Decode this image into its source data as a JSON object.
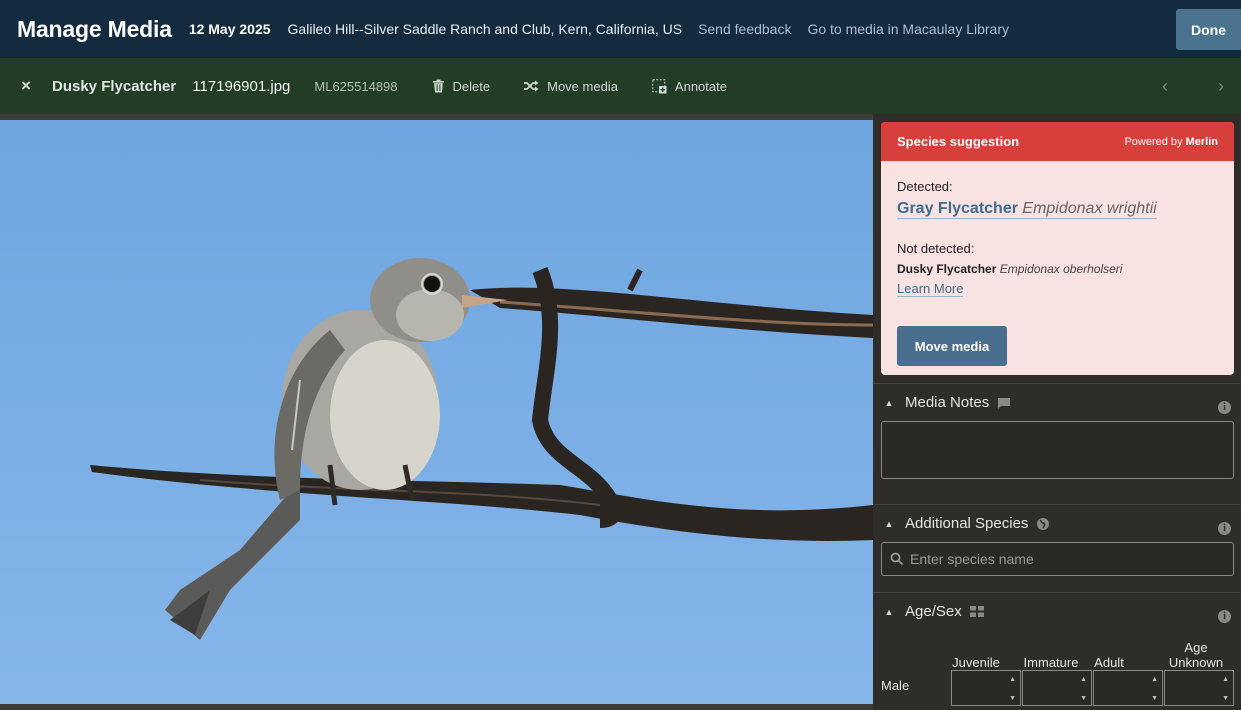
{
  "header": {
    "title": "Manage Media",
    "date": "12 May 2025",
    "location": "Galileo Hill--Silver Saddle Ranch and Club, Kern, California, US",
    "feedback_link": "Send feedback",
    "library_link": "Go to media in Macaulay Library",
    "done_label": "Done"
  },
  "toolbar": {
    "close_icon": "×",
    "species": "Dusky Flycatcher",
    "filename": "117196901.jpg",
    "ml_id": "ML625514898",
    "delete_label": "Delete",
    "move_label": "Move media",
    "annotate_label": "Annotate",
    "prev_icon": "‹",
    "next_icon": "›"
  },
  "suggestion": {
    "heading": "Species suggestion",
    "powered_prefix": "Powered by",
    "powered_brand": "Merlin",
    "detected_label": "Detected:",
    "detected_common": "Gray Flycatcher",
    "detected_sci": "Empidonax wrightii",
    "not_detected_label": "Not detected:",
    "not_detected_common": "Dusky Flycatcher",
    "not_detected_sci": "Empidonax oberholseri",
    "learn_more": "Learn More",
    "move_button": "Move media"
  },
  "media_notes": {
    "title": "Media Notes",
    "value": ""
  },
  "additional_species": {
    "title": "Additional Species",
    "placeholder": "Enter species name"
  },
  "age_sex": {
    "title": "Age/Sex",
    "columns": [
      "Juvenile",
      "Immature",
      "Adult",
      "Age Unknown"
    ],
    "rows": [
      "Male"
    ]
  },
  "colors": {
    "header_bg": "#132a3f",
    "toolbar_bg": "#223c25",
    "suggestion_head": "#d63f3a",
    "suggestion_bg": "#f8e3e2",
    "accent_button": "#4a6f8e"
  }
}
